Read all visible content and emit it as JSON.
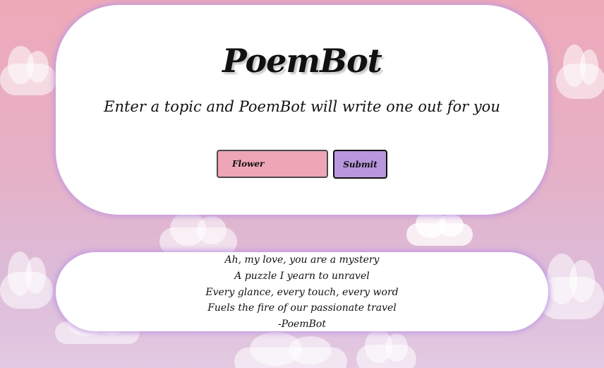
{
  "header": {
    "title": "PoemBot",
    "subtitle": "Enter a topic and PoemBot will write one out for you"
  },
  "form": {
    "topic_value": "Flower",
    "submit_label": "Submit"
  },
  "poem": {
    "lines": [
      "Ah, my love, you are a mystery",
      "A puzzle I yearn to unravel",
      "Every glance, every touch, every word",
      "Fuels the fire of our passionate travel",
      "-PoemBot"
    ]
  },
  "colors": {
    "input_bg": "#eea5b6",
    "button_bg": "#b996dd",
    "card_glow": "#be96e1",
    "background_top": "#eea9b8",
    "background_bottom": "#e3c9e2"
  }
}
